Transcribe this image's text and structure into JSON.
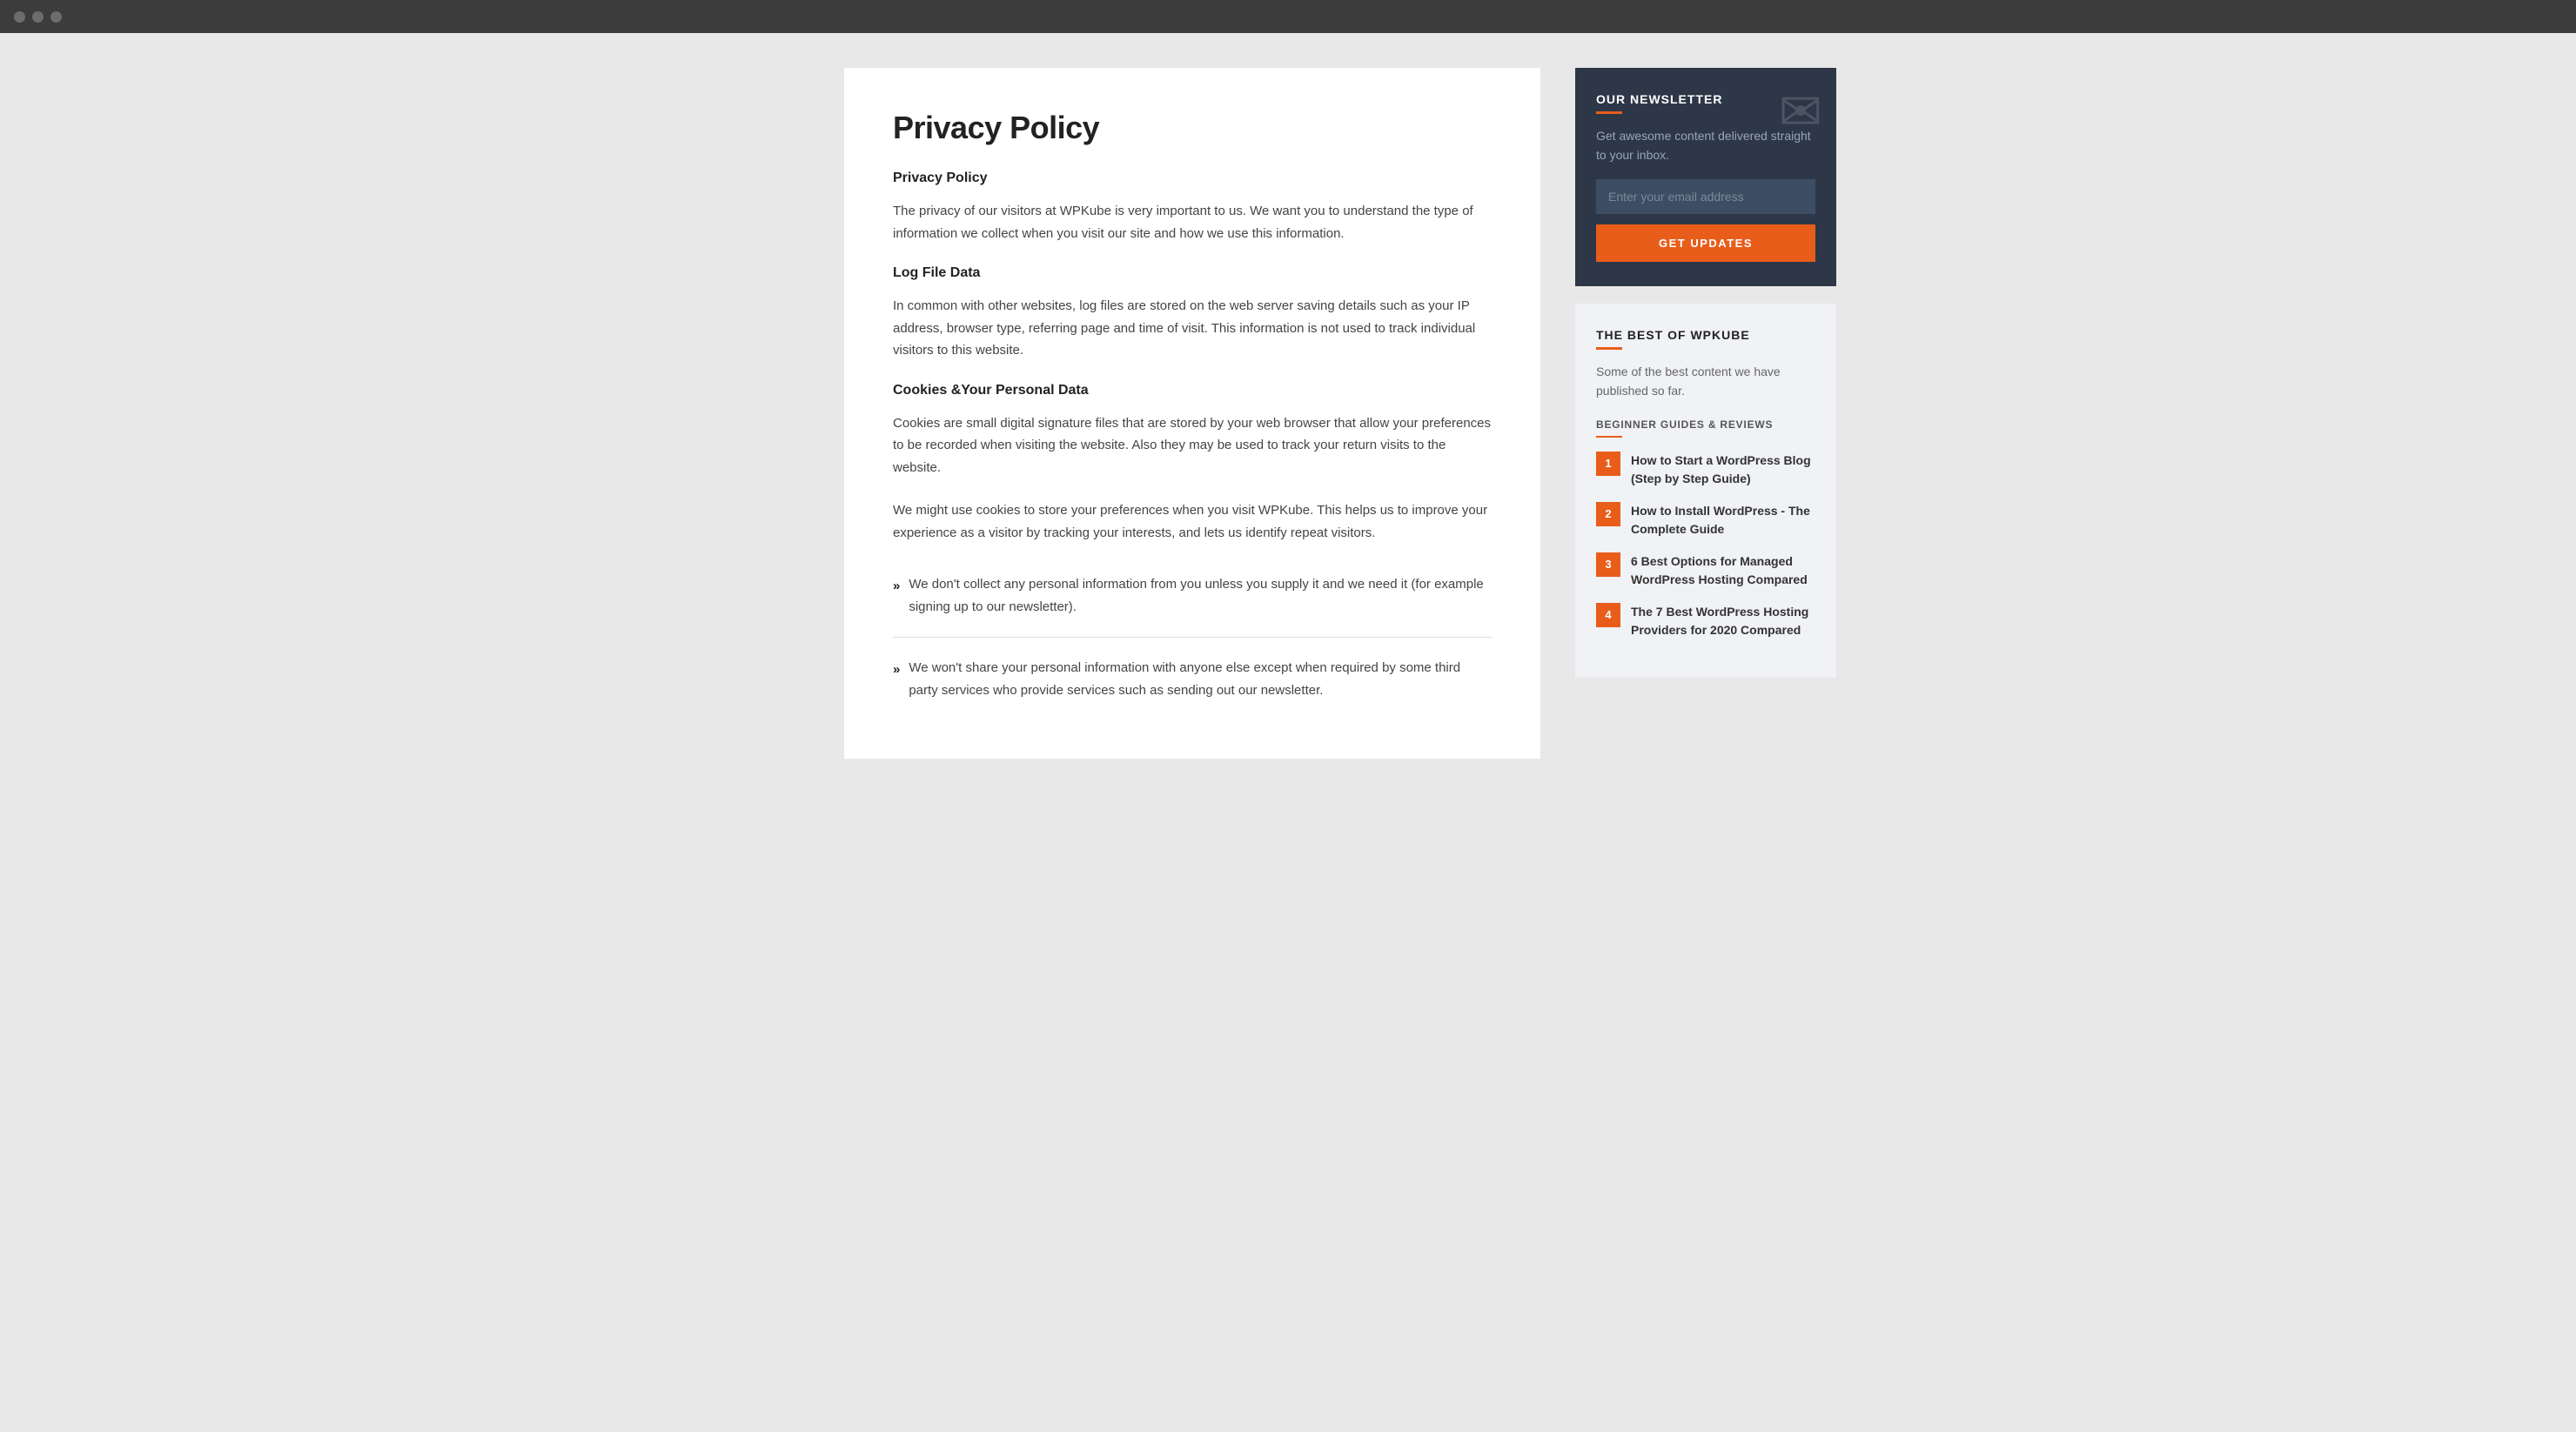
{
  "browser": {
    "dots": [
      "dot1",
      "dot2",
      "dot3"
    ]
  },
  "main": {
    "page_title": "Privacy Policy",
    "section1": {
      "heading": "Privacy Policy",
      "paragraph": "The privacy of our visitors at WPKube is very important to us. We want you to understand the type of information we collect when you visit our site and how we use this information."
    },
    "section2": {
      "heading": "Log File Data",
      "paragraph": "In common with other websites, log files are stored on the web server saving details such as your IP address, browser type, referring page and time of visit. This information is not used to track individual visitors to this website."
    },
    "section3": {
      "heading": "Cookies &Your Personal Data",
      "paragraph": "Cookies are small digital signature files that are stored by your web browser that allow your preferences to be recorded when visiting the website. Also they may be used to track your return visits to the website."
    },
    "section4": {
      "paragraph": "We might use cookies to store your preferences when you visit WPKube. This helps us to improve your experience as a visitor by tracking your interests, and lets us identify repeat visitors."
    },
    "list_items": [
      "We don't collect any personal information from you unless you supply it and we need it (for example signing up to our newsletter).",
      "We won't share your personal information with anyone else except when required by some third party services who provide services such as sending out our newsletter."
    ]
  },
  "sidebar": {
    "newsletter": {
      "title": "OUR NEWSLETTER",
      "description": "Get awesome content delivered straight to your inbox.",
      "input_placeholder": "Enter your email address",
      "button_label": "GET UPDATES"
    },
    "best_of": {
      "title": "THE BEST OF WPKUBE",
      "description": "Some of the best content we have published so far.",
      "category": "BEGINNER GUIDES & REVIEWS",
      "articles": [
        {
          "number": "1",
          "title": "How to Start a WordPress Blog (Step by Step Guide)"
        },
        {
          "number": "2",
          "title": "How to Install WordPress - The Complete Guide"
        },
        {
          "number": "3",
          "title": "6 Best Options for Managed WordPress Hosting Compared"
        },
        {
          "number": "4",
          "title": "The 7 Best WordPress Hosting Providers for 2020 Compared"
        }
      ]
    }
  },
  "colors": {
    "accent": "#e85d1a",
    "dark_bg": "#2d3748",
    "light_bg": "#f0f2f5"
  }
}
